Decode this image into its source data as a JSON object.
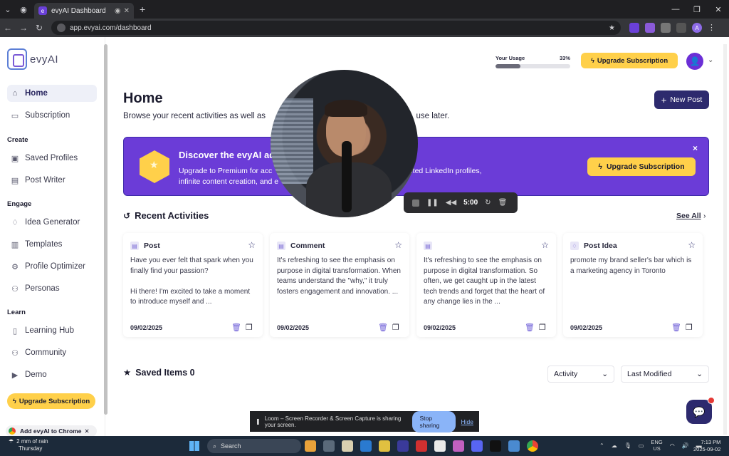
{
  "browser": {
    "tab_title": "evyAI Dashboard",
    "url": "app.evyai.com/dashboard"
  },
  "sidebar": {
    "logo": "evyAI",
    "top_items": [
      {
        "label": "Home",
        "icon": "home-icon"
      },
      {
        "label": "Subscription",
        "icon": "card-icon"
      }
    ],
    "sections": [
      {
        "title": "Create",
        "items": [
          {
            "label": "Saved Profiles",
            "icon": "profile-icon"
          },
          {
            "label": "Post Writer",
            "icon": "document-icon"
          }
        ]
      },
      {
        "title": "Engage",
        "items": [
          {
            "label": "Idea Generator",
            "icon": "lightbulb-icon"
          },
          {
            "label": "Templates",
            "icon": "template-icon"
          },
          {
            "label": "Profile Optimizer",
            "icon": "user-gear-icon"
          },
          {
            "label": "Personas",
            "icon": "users-icon"
          }
        ]
      },
      {
        "title": "Learn",
        "items": [
          {
            "label": "Learning Hub",
            "icon": "book-icon"
          },
          {
            "label": "Community",
            "icon": "community-icon"
          },
          {
            "label": "Demo",
            "icon": "play-icon"
          }
        ]
      }
    ],
    "upgrade_label": "Upgrade Subscription",
    "chrome_label": "Add evyAI to Chrome"
  },
  "header": {
    "usage_label": "Your Usage",
    "usage_percent_text": "33%",
    "usage_fraction": 0.33,
    "upgrade_label": "Upgrade Subscription"
  },
  "main": {
    "title": "Home",
    "subtitle_left": "Browse your recent activities as well as",
    "subtitle_right": "use later.",
    "new_post_label": "New Post"
  },
  "banner": {
    "title": "Discover the evyAI ad",
    "body_line1_left": "Upgrade to Premium for acc",
    "body_line1_right": "ited LinkedIn profiles,",
    "body_line2": "infinite content creation, and e",
    "button_label": "Upgrade Subscription",
    "close_label": "×"
  },
  "recent": {
    "title": "Recent Activities",
    "see_all": "See All",
    "cards": [
      {
        "type": "Post",
        "body": "Have you ever felt that spark when you finally find your passion?\n\nHi there! I'm excited to take a moment to introduce myself and ...",
        "date": "09/02/2025"
      },
      {
        "type": "Comment",
        "body": "It's refreshing to see the emphasis on purpose in digital transformation. When teams understand the \"why,\" it truly fosters engagement and innovation. ...",
        "date": "09/02/2025"
      },
      {
        "type": "",
        "body": "It's refreshing to see the emphasis on purpose in digital transformation. So often, we get caught up in the latest tech trends and forget that the heart of any change lies in the ...",
        "date": "09/02/2025"
      },
      {
        "type": "Post Idea",
        "body": "promote my brand seller's bar which is a marketing agency in Toronto",
        "date": "09/02/2025"
      }
    ]
  },
  "saved": {
    "title": "Saved Items 0",
    "filter_label": "Activity",
    "sort_label": "Last Modified"
  },
  "recorder": {
    "time": "5:00"
  },
  "share_bar": {
    "message": "Loom – Screen Recorder & Screen Capture is sharing your screen.",
    "stop_label": "Stop sharing",
    "hide_label": "Hide"
  },
  "taskbar": {
    "weather_line1": "2 mm of rain",
    "weather_line2": "Thursday",
    "search_placeholder": "Search",
    "lang_line1": "ENG",
    "lang_line2": "US",
    "time": "7:13 PM",
    "date": "2025-09-02"
  }
}
